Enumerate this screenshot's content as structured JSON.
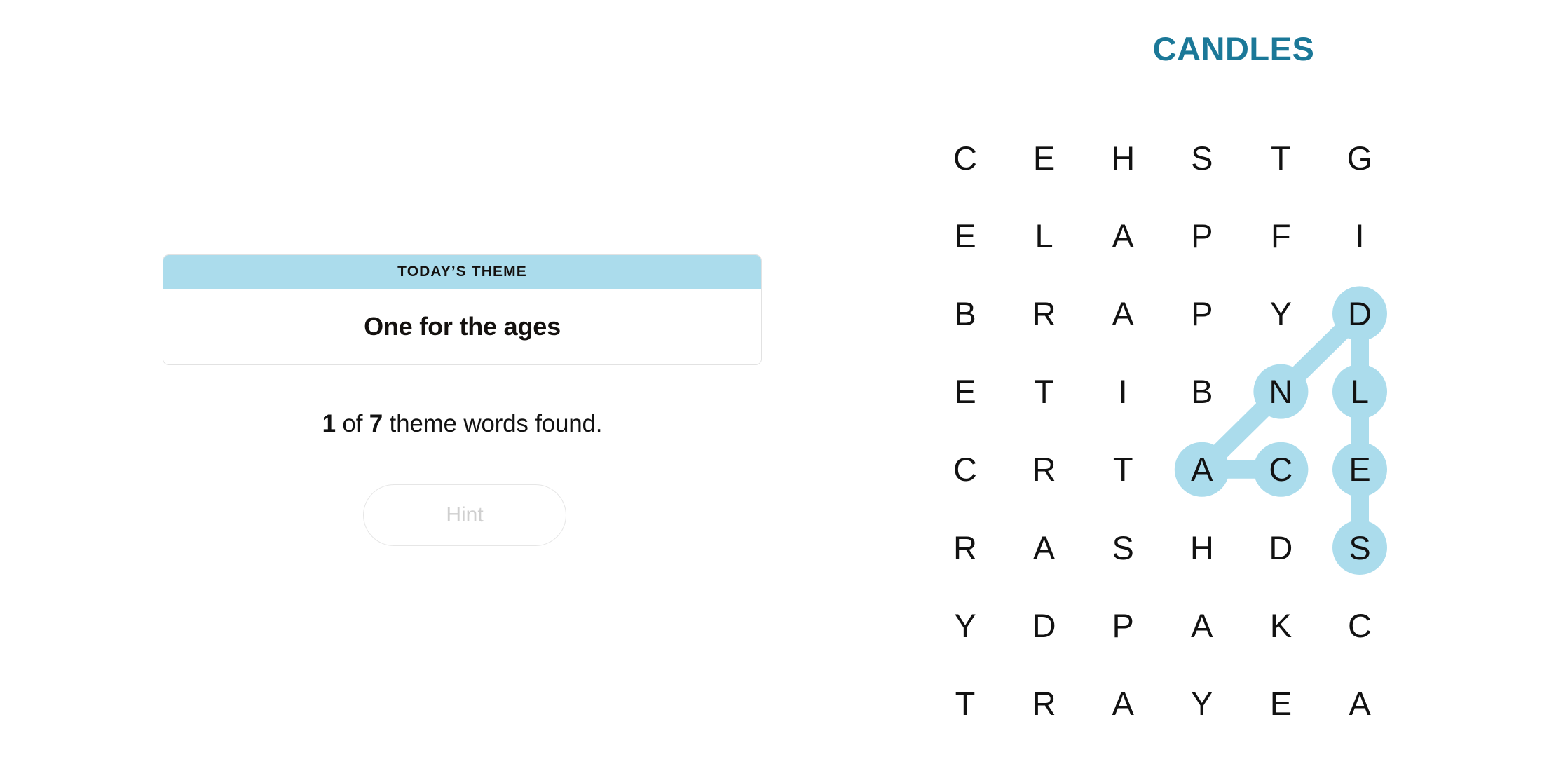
{
  "puzzle": {
    "title": "CANDLES",
    "title_color": "#1b7898",
    "highlight_color": "#abdcec",
    "grid": {
      "rows": 8,
      "cols": 6,
      "letters": [
        [
          "C",
          "E",
          "H",
          "S",
          "T",
          "G"
        ],
        [
          "E",
          "L",
          "A",
          "P",
          "F",
          "I"
        ],
        [
          "B",
          "R",
          "A",
          "P",
          "Y",
          "D"
        ],
        [
          "E",
          "T",
          "I",
          "B",
          "N",
          "L"
        ],
        [
          "C",
          "R",
          "T",
          "A",
          "C",
          "E"
        ],
        [
          "R",
          "A",
          "S",
          "H",
          "D",
          "S"
        ],
        [
          "Y",
          "D",
          "P",
          "A",
          "K",
          "C"
        ],
        [
          "T",
          "R",
          "A",
          "Y",
          "E",
          "A"
        ]
      ]
    },
    "found_words": [
      {
        "word": "CANDLES",
        "path": [
          {
            "row": 4,
            "col": 4,
            "letter": "A"
          },
          {
            "row": 4,
            "col": 5,
            "letter": "C"
          },
          {
            "row": 3,
            "col": 4,
            "letter": "N"
          },
          {
            "row": 2,
            "col": 5,
            "letter": "D"
          },
          {
            "row": 3,
            "col": 5,
            "letter": "L"
          },
          {
            "row": 4,
            "col": 5,
            "letter": "E"
          },
          {
            "row": 5,
            "col": 5,
            "letter": "S"
          }
        ],
        "segments": [
          {
            "from": [
              4,
              3
            ],
            "to": [
              4,
              4
            ]
          },
          {
            "from": [
              4,
              3
            ],
            "to": [
              3,
              4
            ]
          },
          {
            "from": [
              3,
              4
            ],
            "to": [
              2,
              5
            ]
          },
          {
            "from": [
              2,
              5
            ],
            "to": [
              3,
              5
            ]
          },
          {
            "from": [
              3,
              5
            ],
            "to": [
              4,
              5
            ]
          },
          {
            "from": [
              4,
              5
            ],
            "to": [
              5,
              5
            ]
          }
        ],
        "highlighted_cells": [
          [
            4,
            3
          ],
          [
            4,
            4
          ],
          [
            3,
            4
          ],
          [
            2,
            5
          ],
          [
            3,
            5
          ],
          [
            4,
            5
          ],
          [
            5,
            5
          ]
        ]
      }
    ]
  },
  "theme_card": {
    "header_label": "TODAY’S THEME",
    "phrase": "One for the ages",
    "header_bg": "#abdcec"
  },
  "progress": {
    "found_count": "1",
    "middle_text": " of ",
    "total_count": "7",
    "suffix_text": " theme words found."
  },
  "hint_button": {
    "label": "Hint",
    "disabled": true
  }
}
